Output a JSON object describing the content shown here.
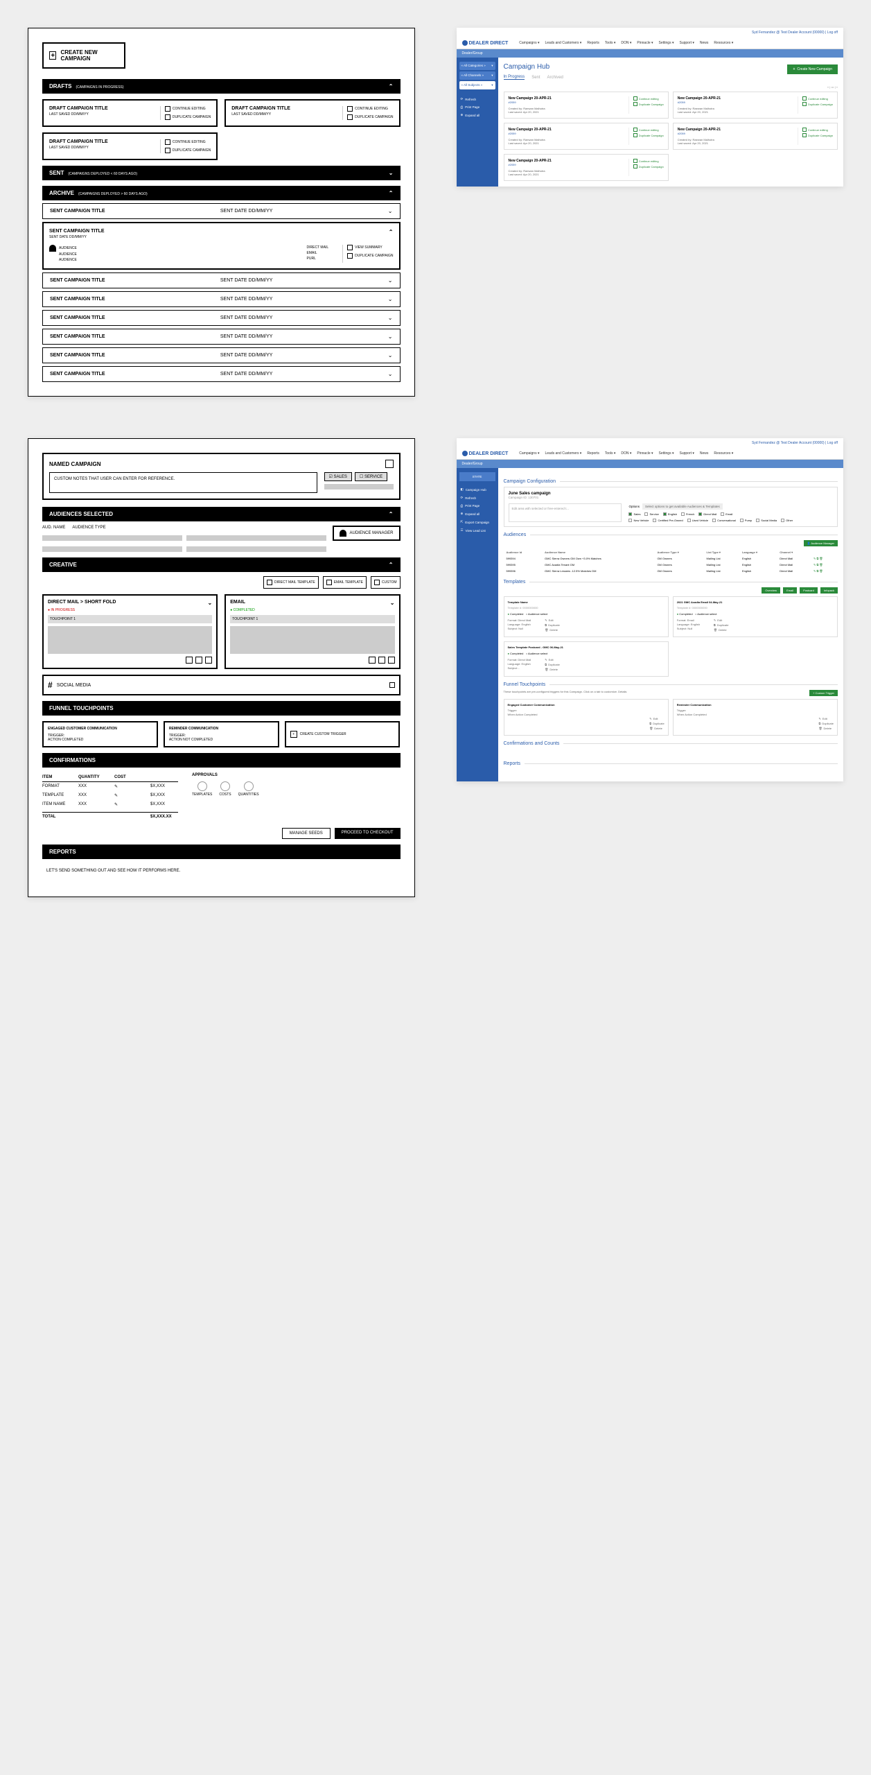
{
  "wf1": {
    "create_btn": "CREATE NEW CAMPAIGN",
    "drafts_bar": "DRAFTS",
    "drafts_sub": "(CAMPAIGNS IN PROGRESS)",
    "draft_title": "DRAFT CAMPAIGN TITLE",
    "draft_sub": "LAST SAVED DD/MM/YY",
    "cont_edit": "CONTINUE EDITING",
    "dup_camp": "DUPLICATE CAMPAIGN",
    "sent_bar": "SENT",
    "sent_sub": "(CAMPAIGNS DEPLOYED < 60 DAYS AGO)",
    "archive_bar": "ARCHIVE",
    "archive_sub": "(CAMPAIGNS DEPLOYED > 60 DAYS AGO)",
    "sent_title": "SENT CAMPAIGN TITLE",
    "sent_date": "SENT DATE DD/MM/YY",
    "audience": "AUDIENCE",
    "dm": "DIRECT MAIL",
    "email": "EMAIL",
    "purl": "PURL",
    "view_sum": "VIEW SUMMARY",
    "dup": "DUPLICATE CAMPAIGN"
  },
  "app1": {
    "user": "Syd Fernandez @ Test Dealer Account (00000) | Log off",
    "nav": [
      "Campaigns ▾",
      "Leads and Customers ▾",
      "Reports",
      "Tools ▾",
      "DON ▾",
      "Pinnacle ▾",
      "Settings ▾",
      "Support ▾",
      "News",
      "Resources ▾"
    ],
    "logo": "DEALER DIRECT",
    "side_header": "Dealer/Group",
    "filters": [
      "« All Categories »",
      "« All Channels »",
      "« All Subjects »"
    ],
    "links": [
      "Refresh",
      "Print Page",
      "Expand all"
    ],
    "title": "Campaign Hub",
    "tabs": [
      "In Progress",
      "Sent",
      "Archived"
    ],
    "create": "Create New Campaign",
    "pager": "« | ••• | »",
    "camp_title": "New Campaign 20-APR-21",
    "camp_id": "#2059",
    "camp_by": "Created by: Raewan Malhotra",
    "camp_saved": "Last saved: Apr 20, 2021",
    "cont": "Continue editing",
    "dup": "Duplicate Campaign"
  },
  "wf2": {
    "named": "NAMED CAMPAIGN",
    "notes": "CUSTOM NOTES THAT USER CAN ENTER FOR REFERENCE.",
    "sales": "SALES",
    "service": "SERVICE",
    "aud_sel": "AUDIENCES SELECTED",
    "aud_name": "AUD. NAME",
    "aud_type": "AUDIENCE TYPE",
    "aud_mgr": "AUDIENCE MANAGER",
    "creative": "CREATIVE",
    "dm_tmpl": "DIRECT MAIL TEMPLATE",
    "em_tmpl": "EMAIL TEMPLATE",
    "custom": "CUSTOM",
    "dm_short": "DIRECT MAIL > SHORT FOLD",
    "email": "EMAIL",
    "in_prog": "● IN PROGRESS",
    "completed": "● COMPLETED",
    "tp1": "TOUCHPOINT 1",
    "social": "SOCIAL MEDIA",
    "funnel": "FUNNEL TOUCHPOINTS",
    "engaged": "ENGAGED CUSTOMER COMMUNICATION",
    "reminder": "REMINDER COMMUNICATION",
    "trigger": "TRIGGER:",
    "act_comp": "ACTION COMPLETED",
    "act_not": "ACTION NOT COMPLETED",
    "create_trig": "CREATE CUSTOM TRIGGER",
    "confirm": "CONFIRMATIONS",
    "item": "ITEM",
    "qty": "QUANTITY",
    "cost": "COST",
    "format": "FORMAT",
    "template": "TEMPLATE",
    "item_name": "ITEM NAME",
    "xxx": "XXX",
    "xxxx": "$X,XXX",
    "total": "TOTAL",
    "total_amt": "$X,XXX.XX",
    "approvals": "APPROVALS",
    "templates": "TEMPLATES",
    "costs": "COSTS",
    "quantities": "QUANTITIES",
    "seeds": "MANAGE SEEDS",
    "checkout": "PROCEED TO CHECKOUT",
    "reports": "REPORTS",
    "reports_txt": "LET'S SEND SOMETHING OUT AND SEE HOW IT PERFORMS HERE."
  },
  "app2": {
    "side_state": "STATE",
    "side_links": [
      "Campaign Hub",
      "Refresh",
      "Print Page",
      "Expand all",
      "Export Campaign",
      "View Lead List"
    ],
    "config": "Campaign Configuration",
    "camp_name": "June Sales campaign",
    "camp_id": "Campaign ID: 130701",
    "note_hint": "Edit area with selected or free-entered t...",
    "options": "Options",
    "opt_hint": "Select options to get available Audiences & Templates",
    "opts": [
      "Sales",
      "Service",
      "English",
      "French",
      "Direct Mail",
      "Email"
    ],
    "opts2": [
      "New Vehicle",
      "Certified Pre-Owned",
      "Used Vehicle",
      "Conversational",
      "Pump",
      "Social Media",
      "Other"
    ],
    "audiences": "Audiences",
    "aud_mgr": "Audience Manager",
    "aud_cols": [
      "Audience Id",
      "Audience Name",
      "Audience Type ▾",
      "List Type ▾",
      "Language ▾",
      "Channel ▾"
    ],
    "aud_rows": [
      [
        "599394",
        "GMC Sierra Owners GM Own +3.0% Matches",
        "GM Owners",
        "Mailing List",
        "English",
        "Direct Mail"
      ],
      [
        "599395",
        "GMC Acadia Tenant GM",
        "GM Owners",
        "Mailing List",
        "English",
        "Direct Mail"
      ],
      [
        "599396",
        "GMC Sierra Lessees -12.5% Matches DM",
        "GM Owners",
        "Mailing List",
        "English",
        "Direct Mail"
      ]
    ],
    "templates": "Templates",
    "tbtn": [
      "Overview",
      "Email",
      "Postcard",
      "Infopack"
    ],
    "tmpl1_name": "Template Name",
    "tmpl1_sub": "Template #: 0000000000",
    "tmpl2_name": "2021 GMC Acadia Email 04-May-21",
    "tmpl2_sub": "Template #: 0000000000",
    "tmpl3_name": "Sales Template Postcard - GMC 06-May-21",
    "status_comp": "Completed",
    "status_sel": "Audience select",
    "meta_format": "Format:",
    "meta_lang": "Language:",
    "meta_subj": "Subject:",
    "dm_val": "Direct Mail",
    "em_val": "Email",
    "en_val": "English",
    "null_val": "Null",
    "edit": "Edit",
    "dup": "Duplicate",
    "del": "Delete",
    "funnel": "Funnel Touchpoints",
    "funnel_hint": "These touchpoints are pre-configured triggers for this Campaign. Click on a tab to customize. Details",
    "custom_trig": "Custom Trigger",
    "engaged": "Engaged Customer Communication",
    "reminder": "Reminder Communication",
    "trigger": "Trigger:",
    "when": "When Action Completed",
    "confirm": "Confirmations and Counts",
    "reports": "Reports"
  }
}
